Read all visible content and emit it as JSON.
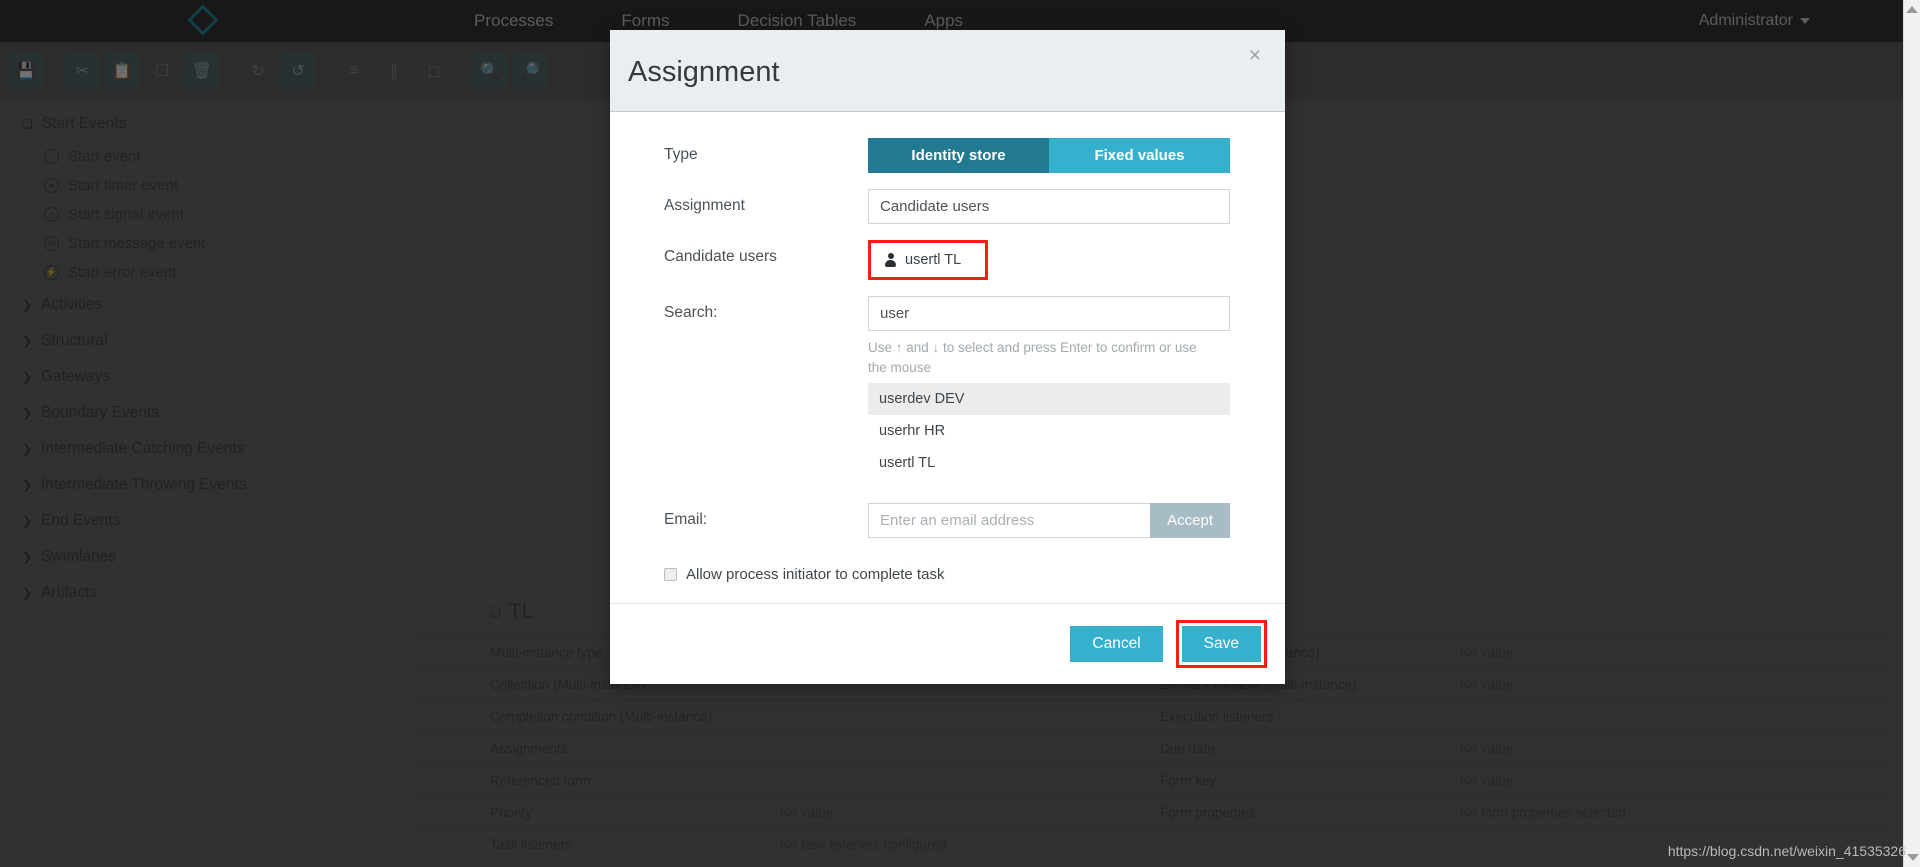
{
  "app": {
    "nav_links": [
      "Processes",
      "Forms",
      "Decision Tables",
      "Apps"
    ],
    "user_menu": "Administrator",
    "logo_icon": "diamond-logo-icon",
    "toolbar_icons": [
      "save-icon",
      "cut-icon",
      "copy-icon",
      "paste-icon",
      "delete-icon",
      "redo-icon",
      "undo-icon",
      "align-horizontal-icon",
      "align-vertical-icon",
      "same-size-icon",
      "zoom-in-icon",
      "zoom-out-icon"
    ]
  },
  "palette": {
    "groups": [
      {
        "label": "Start Events",
        "expanded": true,
        "items": [
          {
            "label": "Start event",
            "icon": "circle-icon"
          },
          {
            "label": "Start timer event",
            "icon": "timer-circle-icon"
          },
          {
            "label": "Start signal event",
            "icon": "signal-circle-icon"
          },
          {
            "label": "Start message event",
            "icon": "message-circle-icon"
          },
          {
            "label": "Start error event",
            "icon": "error-circle-icon"
          }
        ]
      },
      {
        "label": "Activities",
        "expanded": false,
        "items": []
      },
      {
        "label": "Structural",
        "expanded": false,
        "items": []
      },
      {
        "label": "Gateways",
        "expanded": false,
        "items": []
      },
      {
        "label": "Boundary Events",
        "expanded": false,
        "items": []
      },
      {
        "label": "Intermediate Catching Events",
        "expanded": false,
        "items": []
      },
      {
        "label": "Intermediate Throwing Events",
        "expanded": false,
        "items": []
      },
      {
        "label": "End Events",
        "expanded": false,
        "items": []
      },
      {
        "label": "Swimlanes",
        "expanded": false,
        "items": []
      },
      {
        "label": "Artifacts",
        "expanded": false,
        "items": []
      }
    ]
  },
  "properties": {
    "title": "TL",
    "rows": [
      {
        "label": "Multi-instance type :",
        "value": "",
        "label2": "Cardinality (Multi-instance) :",
        "value2": "No value"
      },
      {
        "label": "Collection (Multi-instance) :",
        "value": "",
        "label2": "Element variable (Multi-instance) :",
        "value2": "No value"
      },
      {
        "label": "Completion condition (Multi-instance) :",
        "value": "",
        "label2": "Execution listeners :",
        "value2": ""
      },
      {
        "label": "Assignments :",
        "value": "",
        "label2": "Due date :",
        "value2": "No value"
      },
      {
        "label": "Referenced form :",
        "value": "",
        "label2": "Form key :",
        "value2": "No value"
      },
      {
        "label": "Priority :",
        "value": "No value",
        "label2": "Form properties :",
        "value2": "No form properties selected"
      },
      {
        "label": "Task listeners :",
        "value": "No task listeners configured",
        "label2": "",
        "value2": ""
      }
    ]
  },
  "watermark": "https://blog.csdn.net/weixin_41535326",
  "modal": {
    "title": "Assignment",
    "close_icon": "close-icon",
    "type": {
      "label": "Type",
      "options": [
        "Identity store",
        "Fixed values"
      ],
      "selected": "Identity store"
    },
    "assignment": {
      "label": "Assignment",
      "value": "Candidate users"
    },
    "candidate_users": {
      "label": "Candidate users",
      "chips": [
        {
          "name": "usertl TL",
          "icon": "person-icon"
        }
      ]
    },
    "search": {
      "label": "Search:",
      "value": "user",
      "helper": "Use ↑ and ↓ to select and press Enter to confirm or use the mouse",
      "results": [
        {
          "label": "userdev DEV",
          "highlighted": true
        },
        {
          "label": "userhr HR",
          "highlighted": false
        },
        {
          "label": "usertl TL",
          "highlighted": false
        }
      ]
    },
    "email": {
      "label": "Email:",
      "value": "",
      "placeholder": "Enter an email address",
      "accept_label": "Accept"
    },
    "allow_initiator": {
      "label": "Allow process initiator to complete task",
      "checked": false
    },
    "footer": {
      "cancel_label": "Cancel",
      "save_label": "Save"
    }
  },
  "colors": {
    "accent_teal_dark": "#217a91",
    "accent_teal_light": "#35b1cd",
    "accept_grey": "#a7bcc4",
    "highlight_red": "#fb1b11",
    "modal_header_bg": "#e9eef1"
  }
}
